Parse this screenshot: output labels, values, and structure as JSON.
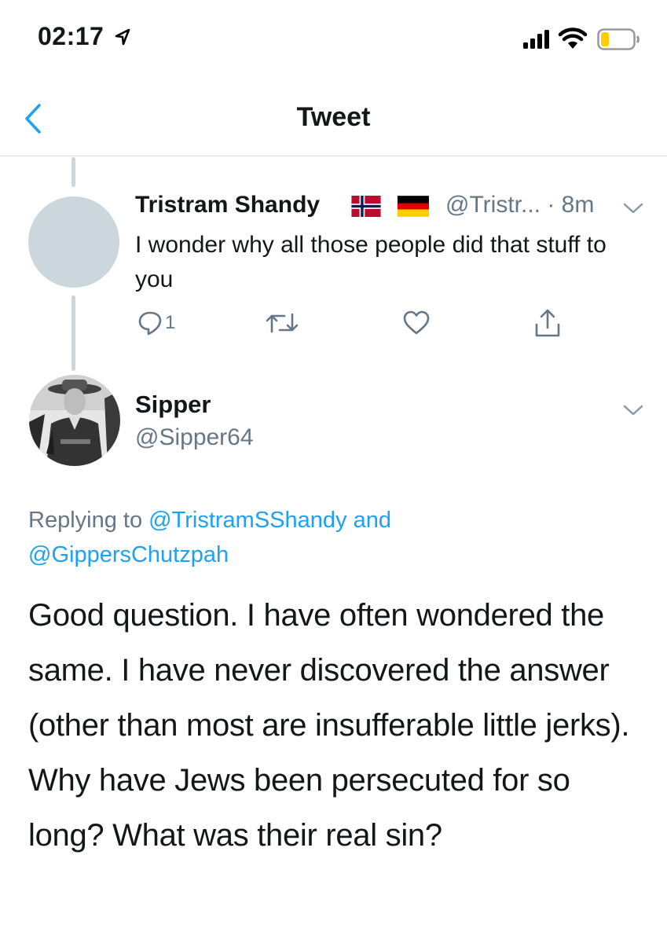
{
  "status_bar": {
    "time": "02:17",
    "icons": [
      "location-arrow-icon",
      "signal-icon",
      "wifi-icon",
      "battery-low-icon"
    ]
  },
  "header": {
    "title": "Tweet",
    "back_icon": "chevron-left-icon"
  },
  "colors": {
    "accent": "#1da1f2",
    "text": "#14171a",
    "muted": "#657786",
    "placeholder_avatar": "#ccd6dd",
    "battery_fill": "#ffcc00"
  },
  "tweet_parent": {
    "name": "Tristram Shandy",
    "flags": [
      "flag-norway-icon",
      "flag-germany-icon"
    ],
    "meta": "@Tristr... · 8m",
    "text": "I wonder why all those people did that stuff to you",
    "actions": {
      "reply_count": "1",
      "icons": [
        "reply-icon",
        "retweet-icon",
        "like-icon",
        "share-icon"
      ]
    }
  },
  "tweet_main": {
    "name": "Sipper",
    "handle": "@Sipper64",
    "replying_prefix": "Replying to",
    "replying_user1": "@TristramSShandy",
    "replying_and": "and",
    "replying_user2": "@GippersChutzpah",
    "text": "Good question. I have often wondered the same. I have never discovered the answer (other than most are insufferable little jerks). Why have Jews been persecuted for so long? What was their real sin?"
  }
}
